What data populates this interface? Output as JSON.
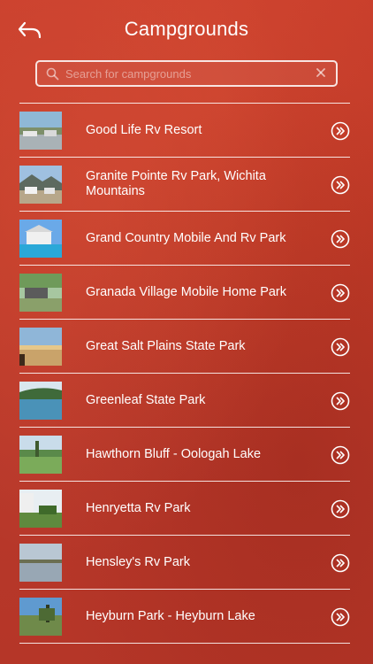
{
  "header": {
    "title": "Campgrounds",
    "back_icon": "back-arrow-icon"
  },
  "search": {
    "placeholder": "Search for campgrounds",
    "value": ""
  },
  "items": [
    {
      "label": "Good Life Rv Resort"
    },
    {
      "label": "Granite Pointe Rv Park, Wichita Mountains"
    },
    {
      "label": "Grand Country Mobile And Rv Park"
    },
    {
      "label": "Granada Village Mobile Home Park"
    },
    {
      "label": "Great Salt Plains State Park"
    },
    {
      "label": "Greenleaf State Park"
    },
    {
      "label": "Hawthorn Bluff - Oologah Lake"
    },
    {
      "label": "Henryetta Rv Park"
    },
    {
      "label": "Hensley's Rv Park"
    },
    {
      "label": "Heyburn Park - Heyburn Lake"
    }
  ],
  "colors": {
    "background": "#c13b28",
    "foreground": "#ffffff"
  }
}
